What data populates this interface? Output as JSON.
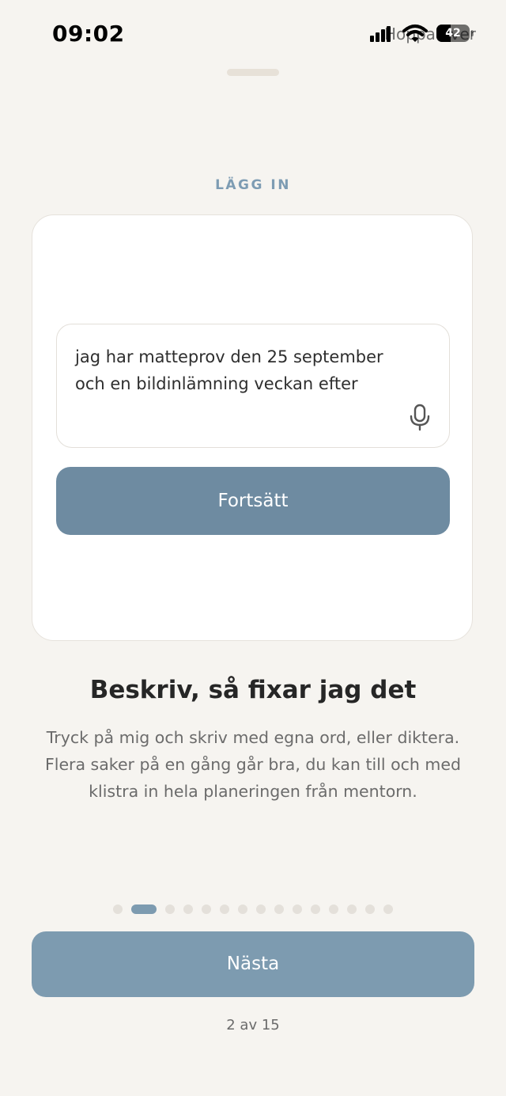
{
  "status_bar": {
    "time": "09:02",
    "battery": "42",
    "battery_level": 0.42,
    "skip_label": "Hoppa över",
    "icons": [
      "signal-icon",
      "wifi-icon",
      "battery-icon"
    ]
  },
  "header": {
    "eyebrow": "LÄGG IN"
  },
  "card": {
    "input_value": "jag har matteprov den 25 september\noch en bildinlämning veckan efter",
    "continue_label": "Fortsätt",
    "icons": [
      "microphone-icon"
    ]
  },
  "content": {
    "title": "Beskriv, så fixar jag det",
    "body": "Tryck på mig och skriv med egna ord, eller diktera.\nFlera saker på en gång går bra, du kan till och med\nklistra in hela planeringen från mentorn."
  },
  "pager": {
    "total": 15,
    "current": 2
  },
  "footer": {
    "next_label": "Nästa",
    "progress_text": "2 av 15"
  },
  "colors": {
    "background": "#f6f4f0",
    "accent": "#7d9bb0",
    "button_dark": "#6e8ba1",
    "card": "#ffffff",
    "eyebrow": "#7d9cb3"
  }
}
